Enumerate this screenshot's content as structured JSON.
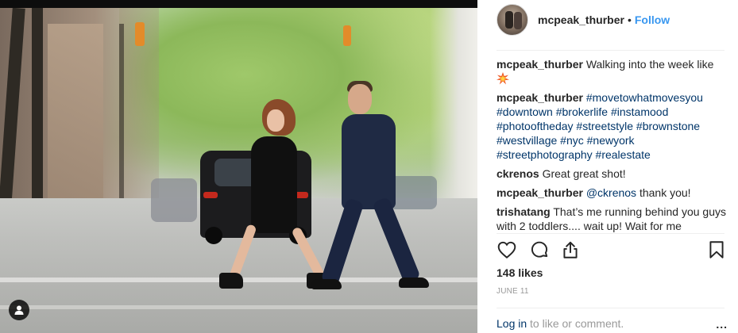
{
  "post": {
    "username": "mcpeak_thurber",
    "follow_label": "Follow",
    "separator": "•"
  },
  "comments": [
    {
      "user": "mcpeak_thurber",
      "text": "Walking into the week like",
      "emoji": "collision-emoji"
    },
    {
      "user": "mcpeak_thurber",
      "tags": [
        "#movetowhatmovesyou",
        "#downtown",
        "#brokerlife",
        "#instamood",
        "#photooftheday",
        "#streetstyle",
        "#brownstone",
        "#westvillage",
        "#nyc",
        "#newyork",
        "#streetphotography",
        "#realestate"
      ]
    },
    {
      "user": "ckrenos",
      "text": "Great great shot!"
    },
    {
      "user": "mcpeak_thurber",
      "mention": "@ckrenos",
      "text": "thank you!"
    },
    {
      "user": "trishatang",
      "text": "That’s me running behind you guys with 2 toddlers.... wait up! Wait for me"
    }
  ],
  "actions": {
    "like_icon": "heart-icon",
    "comment_icon": "comment-icon",
    "share_icon": "share-icon",
    "save_icon": "bookmark-icon"
  },
  "likes": "148 likes",
  "date": "JUNE 11",
  "footer": {
    "login_link": "Log in",
    "login_rest": "to like or comment.",
    "more_label": "..."
  },
  "colors": {
    "link_blue": "#3897f0",
    "hashtag_navy": "#003569",
    "muted_gray": "#999999",
    "text": "#262626"
  }
}
